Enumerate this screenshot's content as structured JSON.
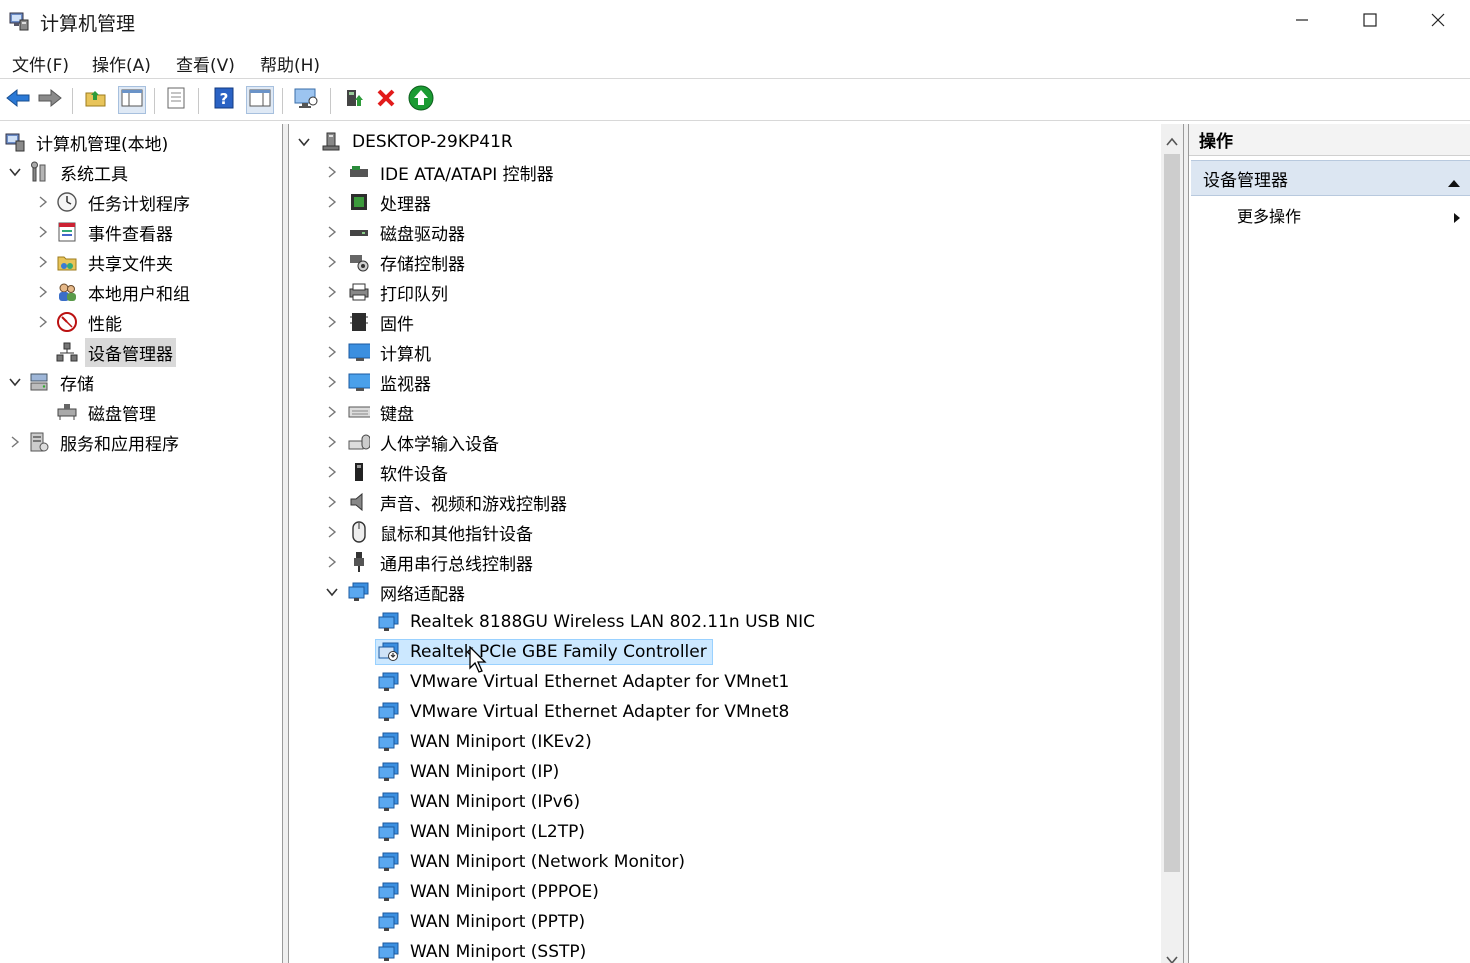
{
  "window": {
    "title": "计算机管理",
    "minimize_icon": "minimize-icon",
    "maximize_icon": "maximize-icon",
    "close_icon": "close-icon"
  },
  "menu": [
    "文件(F)",
    "操作(A)",
    "查看(V)",
    "帮助(H)"
  ],
  "toolbar": {
    "buttons": [
      "back-arrow-icon",
      "forward-arrow-icon",
      "up-folder-icon",
      "show-hide-tree-icon",
      "properties-icon",
      "help-icon",
      "action-pane-icon",
      "monitor-icon",
      "update-driver-icon",
      "uninstall-icon",
      "enable-icon"
    ]
  },
  "left_tree": {
    "root": "计算机管理(本地)",
    "system_tools": "系统工具",
    "task_scheduler": "任务计划程序",
    "event_viewer": "事件查看器",
    "shared_folders": "共享文件夹",
    "local_users": "本地用户和组",
    "performance": "性能",
    "device_manager": "设备管理器",
    "storage": "存储",
    "disk_management": "磁盘管理",
    "services_apps": "服务和应用程序"
  },
  "device_tree": {
    "computer_name": "DESKTOP-29KP41R",
    "categories": [
      "IDE ATA/ATAPI 控制器",
      "处理器",
      "磁盘驱动器",
      "存储控制器",
      "打印队列",
      "固件",
      "计算机",
      "监视器",
      "键盘",
      "人体学输入设备",
      "软件设备",
      "声音、视频和游戏控制器",
      "鼠标和其他指针设备",
      "通用串行总线控制器",
      "网络适配器"
    ],
    "network_adapters": [
      "Realtek 8188GU Wireless LAN 802.11n USB NIC",
      "Realtek PCIe GBE Family Controller",
      "VMware Virtual Ethernet Adapter for VMnet1",
      "VMware Virtual Ethernet Adapter for VMnet8",
      "WAN Miniport (IKEv2)",
      "WAN Miniport (IP)",
      "WAN Miniport (IPv6)",
      "WAN Miniport (L2TP)",
      "WAN Miniport (Network Monitor)",
      "WAN Miniport (PPPOE)",
      "WAN Miniport (PPTP)",
      "WAN Miniport (SSTP)"
    ]
  },
  "actions": {
    "header": "操作",
    "section": "设备管理器",
    "more": "更多操作"
  },
  "colors": {
    "selection_highlight": "#cce8ff",
    "selection_border": "#99d1ff",
    "section_bg": "#dce6f2",
    "monitor_blue": "#1e88e5",
    "uninstall_red": "#e21b1b",
    "enable_green": "#1a9b32"
  }
}
